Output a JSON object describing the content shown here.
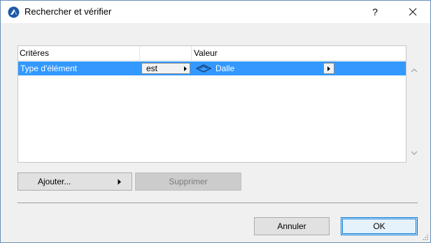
{
  "window": {
    "title": "Rechercher et vérifier",
    "help_label": "?"
  },
  "table": {
    "headers": [
      "Critères",
      "",
      "Valeur"
    ],
    "rows": [
      {
        "criterion": "Type d'élément",
        "operator": "est",
        "value": "Dalle",
        "selected": true
      }
    ]
  },
  "buttons": {
    "add": "Ajouter...",
    "delete": "Supprimer",
    "cancel": "Annuler",
    "ok": "OK"
  },
  "colors": {
    "selection": "#3399ff",
    "accent": "#0078d7",
    "app_icon": "#1e5aa8"
  },
  "icons": {
    "app": "archicad-icon",
    "close": "close-icon",
    "value_type": "slab-icon"
  }
}
